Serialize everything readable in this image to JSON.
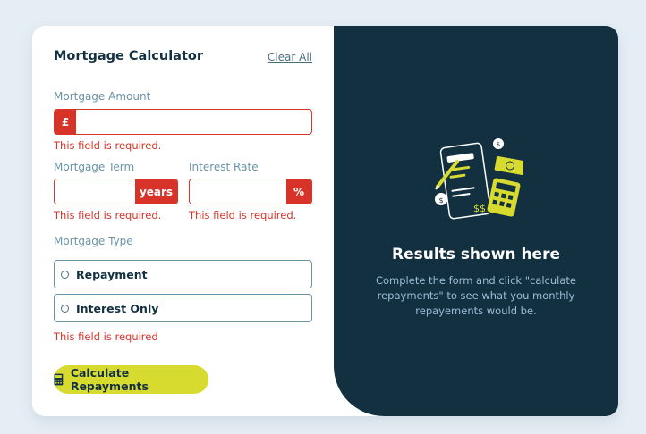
{
  "form": {
    "title": "Mortgage Calculator",
    "clear_all_label": "Clear All",
    "amount": {
      "label": "Mortgage Amount",
      "prefix": "£",
      "value": "",
      "error": "This field is required."
    },
    "term": {
      "label": "Mortgage Term",
      "suffix": "years",
      "value": "",
      "error": "This field is required."
    },
    "rate": {
      "label": "Interest Rate",
      "suffix": "%",
      "value": "",
      "error": "This field is required."
    },
    "type": {
      "label": "Mortgage Type",
      "options": [
        "Repayment",
        "Interest Only"
      ],
      "error": "This field is required"
    },
    "submit_label": "Calculate Repayments"
  },
  "results": {
    "title": "Results shown here",
    "description": "Complete the form and click \"calculate repayments\" to see what you monthly repayements would be."
  },
  "colors": {
    "accent_lime": "#d8db2f",
    "error_red": "#d73328",
    "dark_navy": "#133041",
    "slate": "#6b94a8"
  },
  "icons": [
    "calculator-icon",
    "radio-icon",
    "empty-results-illustration"
  ]
}
